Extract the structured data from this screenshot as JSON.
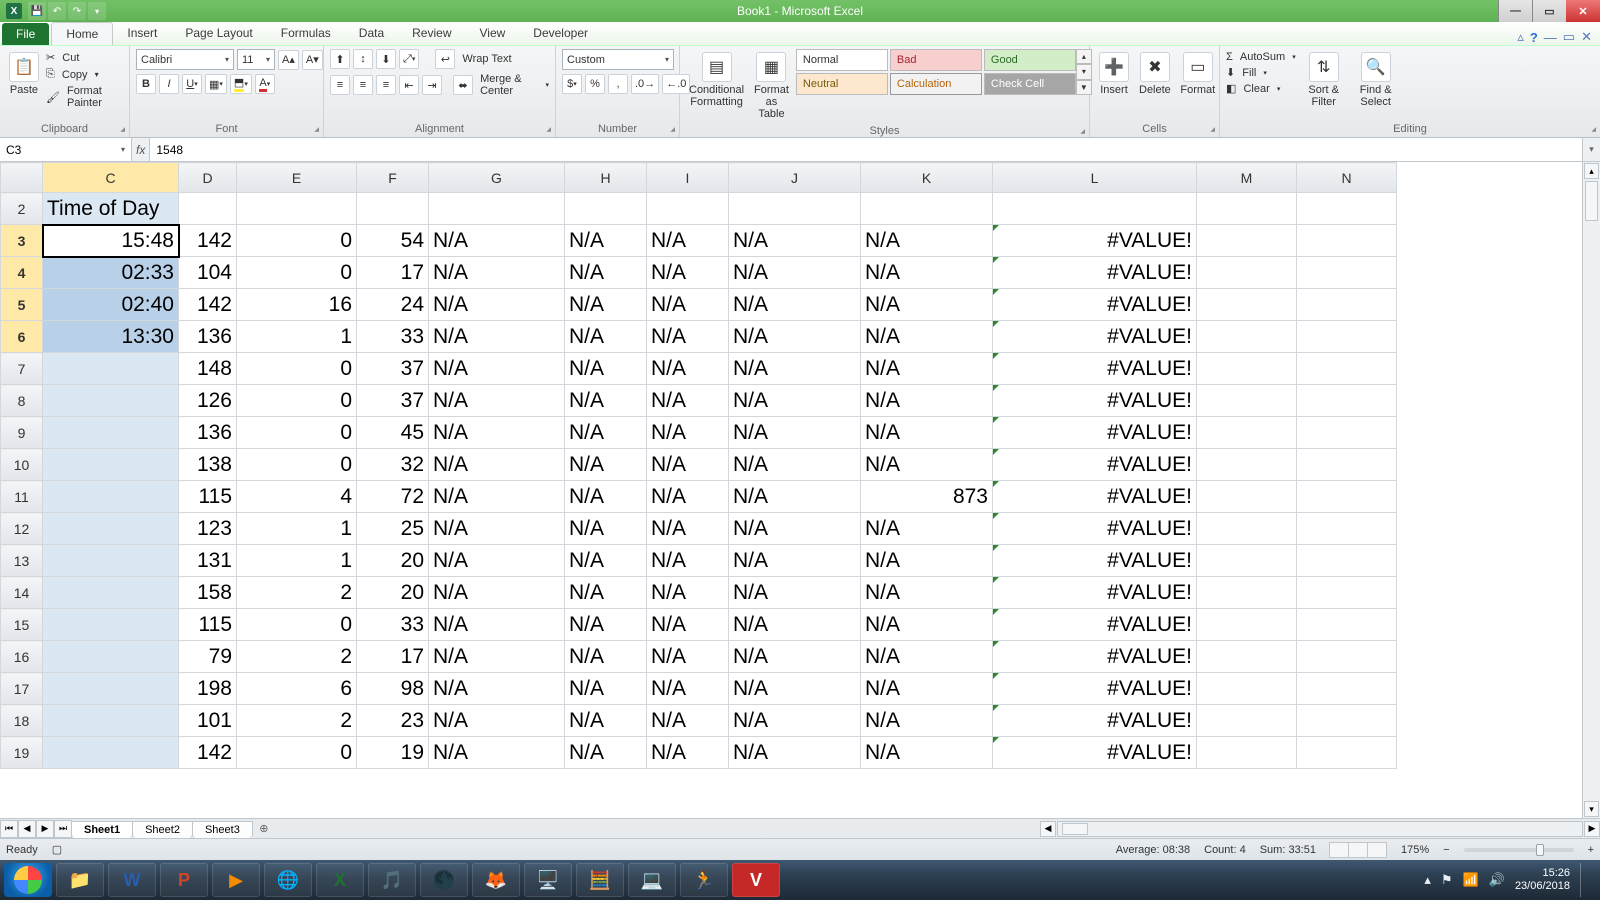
{
  "titlebar": {
    "title": "Book1 - Microsoft Excel"
  },
  "tabs": {
    "file": "File",
    "items": [
      "Home",
      "Insert",
      "Page Layout",
      "Formulas",
      "Data",
      "Review",
      "View",
      "Developer"
    ],
    "active": "Home"
  },
  "ribbon": {
    "clipboard": {
      "paste": "Paste",
      "cut": "Cut",
      "copy": "Copy",
      "fmtpainter": "Format Painter",
      "label": "Clipboard"
    },
    "font": {
      "name": "Calibri",
      "size": "11",
      "label": "Font"
    },
    "alignment": {
      "wrap": "Wrap Text",
      "merge": "Merge & Center",
      "label": "Alignment"
    },
    "number": {
      "format": "Custom",
      "label": "Number"
    },
    "styles": {
      "condfmt": "Conditional Formatting",
      "fmt_table": "Format as Table",
      "normal": "Normal",
      "bad": "Bad",
      "good": "Good",
      "neutral": "Neutral",
      "calc": "Calculation",
      "check": "Check Cell",
      "label": "Styles"
    },
    "cells": {
      "insert": "Insert",
      "delete": "Delete",
      "format": "Format",
      "label": "Cells"
    },
    "editing": {
      "autosum": "AutoSum",
      "fill": "Fill",
      "clear": "Clear",
      "sort": "Sort & Filter",
      "find": "Find & Select",
      "label": "Editing"
    }
  },
  "namebox": "C3",
  "formula": "1548",
  "columns": [
    "C",
    "D",
    "E",
    "F",
    "G",
    "H",
    "I",
    "J",
    "K",
    "L",
    "M",
    "N"
  ],
  "header_row_num": 2,
  "header_C": "Time of Day",
  "selection": {
    "start": 3,
    "end": 6
  },
  "rows": [
    {
      "n": 3,
      "C": "15:48",
      "D": 142,
      "E": 0,
      "F": 54,
      "G": "N/A",
      "H": "N/A",
      "I": "N/A",
      "J": "N/A",
      "K": "N/A",
      "L": "#VALUE!"
    },
    {
      "n": 4,
      "C": "02:33",
      "D": 104,
      "E": 0,
      "F": 17,
      "G": "N/A",
      "H": "N/A",
      "I": "N/A",
      "J": "N/A",
      "K": "N/A",
      "L": "#VALUE!"
    },
    {
      "n": 5,
      "C": "02:40",
      "D": 142,
      "E": 16,
      "F": 24,
      "G": "N/A",
      "H": "N/A",
      "I": "N/A",
      "J": "N/A",
      "K": "N/A",
      "L": "#VALUE!"
    },
    {
      "n": 6,
      "C": "13:30",
      "D": 136,
      "E": 1,
      "F": 33,
      "G": "N/A",
      "H": "N/A",
      "I": "N/A",
      "J": "N/A",
      "K": "N/A",
      "L": "#VALUE!"
    },
    {
      "n": 7,
      "C": "",
      "D": 148,
      "E": 0,
      "F": 37,
      "G": "N/A",
      "H": "N/A",
      "I": "N/A",
      "J": "N/A",
      "K": "N/A",
      "L": "#VALUE!"
    },
    {
      "n": 8,
      "C": "",
      "D": 126,
      "E": 0,
      "F": 37,
      "G": "N/A",
      "H": "N/A",
      "I": "N/A",
      "J": "N/A",
      "K": "N/A",
      "L": "#VALUE!"
    },
    {
      "n": 9,
      "C": "",
      "D": 136,
      "E": 0,
      "F": 45,
      "G": "N/A",
      "H": "N/A",
      "I": "N/A",
      "J": "N/A",
      "K": "N/A",
      "L": "#VALUE!"
    },
    {
      "n": 10,
      "C": "",
      "D": 138,
      "E": 0,
      "F": 32,
      "G": "N/A",
      "H": "N/A",
      "I": "N/A",
      "J": "N/A",
      "K": "N/A",
      "L": "#VALUE!"
    },
    {
      "n": 11,
      "C": "",
      "D": 115,
      "E": 4,
      "F": 72,
      "G": "N/A",
      "H": "N/A",
      "I": "N/A",
      "J": "N/A",
      "K": "873",
      "L": "#VALUE!"
    },
    {
      "n": 12,
      "C": "",
      "D": 123,
      "E": 1,
      "F": 25,
      "G": "N/A",
      "H": "N/A",
      "I": "N/A",
      "J": "N/A",
      "K": "N/A",
      "L": "#VALUE!"
    },
    {
      "n": 13,
      "C": "",
      "D": 131,
      "E": 1,
      "F": 20,
      "G": "N/A",
      "H": "N/A",
      "I": "N/A",
      "J": "N/A",
      "K": "N/A",
      "L": "#VALUE!"
    },
    {
      "n": 14,
      "C": "",
      "D": 158,
      "E": 2,
      "F": 20,
      "G": "N/A",
      "H": "N/A",
      "I": "N/A",
      "J": "N/A",
      "K": "N/A",
      "L": "#VALUE!"
    },
    {
      "n": 15,
      "C": "",
      "D": 115,
      "E": 0,
      "F": 33,
      "G": "N/A",
      "H": "N/A",
      "I": "N/A",
      "J": "N/A",
      "K": "N/A",
      "L": "#VALUE!"
    },
    {
      "n": 16,
      "C": "",
      "D": 79,
      "E": 2,
      "F": 17,
      "G": "N/A",
      "H": "N/A",
      "I": "N/A",
      "J": "N/A",
      "K": "N/A",
      "L": "#VALUE!"
    },
    {
      "n": 17,
      "C": "",
      "D": 198,
      "E": 6,
      "F": 98,
      "G": "N/A",
      "H": "N/A",
      "I": "N/A",
      "J": "N/A",
      "K": "N/A",
      "L": "#VALUE!"
    },
    {
      "n": 18,
      "C": "",
      "D": 101,
      "E": 2,
      "F": 23,
      "G": "N/A",
      "H": "N/A",
      "I": "N/A",
      "J": "N/A",
      "K": "N/A",
      "L": "#VALUE!"
    },
    {
      "n": 19,
      "C": "",
      "D": 142,
      "E": 0,
      "F": 19,
      "G": "N/A",
      "H": "N/A",
      "I": "N/A",
      "J": "N/A",
      "K": "N/A",
      "L": "#VALUE!"
    }
  ],
  "sheets": [
    "Sheet1",
    "Sheet2",
    "Sheet3"
  ],
  "active_sheet": "Sheet1",
  "status": {
    "mode": "Ready",
    "avg": "Average: 08:38",
    "count": "Count: 4",
    "sum": "Sum: 33:51",
    "zoom": "175%"
  },
  "clock": {
    "time": "15:26",
    "date": "23/06/2018"
  }
}
